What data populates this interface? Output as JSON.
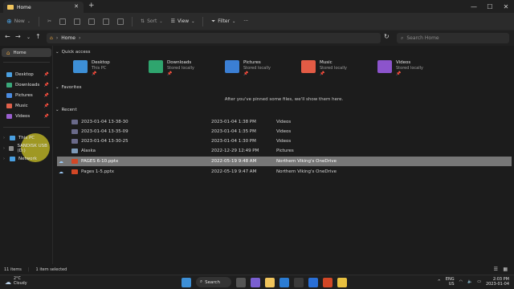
{
  "window": {
    "tab_title": "Home",
    "close_tab": "✕",
    "new_tab": "+",
    "controls": {
      "minimize": "—",
      "maximize": "☐",
      "close": "✕"
    }
  },
  "commandbar": {
    "new_label": "New",
    "sort_label": "Sort",
    "view_label": "View",
    "filter_label": "Filter",
    "more": "···"
  },
  "address": {
    "location": "Home",
    "search_placeholder": "Search Home"
  },
  "sidebar": {
    "home": "Home",
    "pinned": [
      {
        "label": "Desktop",
        "color": "#4a9fe0"
      },
      {
        "label": "Downloads",
        "color": "#3aa87a"
      },
      {
        "label": "Pictures",
        "color": "#4a8be0"
      },
      {
        "label": "Music",
        "color": "#e0604a"
      },
      {
        "label": "Videos",
        "color": "#9a5fd0"
      }
    ],
    "drives": [
      {
        "label": "This PC",
        "color": "#4a9fe0"
      },
      {
        "label": "SANDISK USB (D:)",
        "color": "#8a8a8a"
      },
      {
        "label": "Network",
        "color": "#4a9fe0"
      }
    ]
  },
  "quick_access": {
    "heading": "Quick access",
    "items": [
      {
        "name": "Desktop",
        "sub": "This PC",
        "color": "#3d8fd6"
      },
      {
        "name": "Downloads",
        "sub": "Stored locally",
        "color": "#2fa56e"
      },
      {
        "name": "Pictures",
        "sub": "Stored locally",
        "color": "#3b7fd4"
      },
      {
        "name": "Music",
        "sub": "Stored locally",
        "color": "#e35b45"
      },
      {
        "name": "Videos",
        "sub": "Stored locally",
        "color": "#8c54cc"
      }
    ]
  },
  "favorites": {
    "heading": "Favorites",
    "empty_message": "After you've pinned some files, we'll show them here."
  },
  "recent": {
    "heading": "Recent",
    "rows": [
      {
        "name": "2023-01-04 13-38-30",
        "date": "2023-01-04 1:38 PM",
        "location": "Videos",
        "color": "#6a6a8a"
      },
      {
        "name": "2023-01-04 13-35-09",
        "date": "2023-01-04 1:35 PM",
        "location": "Videos",
        "color": "#6a6a8a"
      },
      {
        "name": "2023-01-04 13-30-25",
        "date": "2023-01-04 1:30 PM",
        "location": "Videos",
        "color": "#6a6a8a"
      },
      {
        "name": "Alaska",
        "date": "2022-12-29 12:49 PM",
        "location": "Pictures",
        "color": "#7d9ab8"
      },
      {
        "name": "PAGES 6-10.pptx",
        "date": "2022-05-19 9:48 AM",
        "location": "Northern Viking's OneDrive",
        "color": "#d24726"
      },
      {
        "name": "Pages 1-5.pptx",
        "date": "2022-05-19 9:47 AM",
        "location": "Northern Viking's OneDrive",
        "color": "#d24726"
      }
    ]
  },
  "status": {
    "items_count": "11 items",
    "selected": "1 item selected"
  },
  "taskbar": {
    "temperature": "2°C",
    "condition": "Cloudy",
    "search_label": "Search",
    "lang_top": "ENG",
    "lang_bottom": "US",
    "time": "2:03 PM",
    "date": "2023-01-04"
  }
}
